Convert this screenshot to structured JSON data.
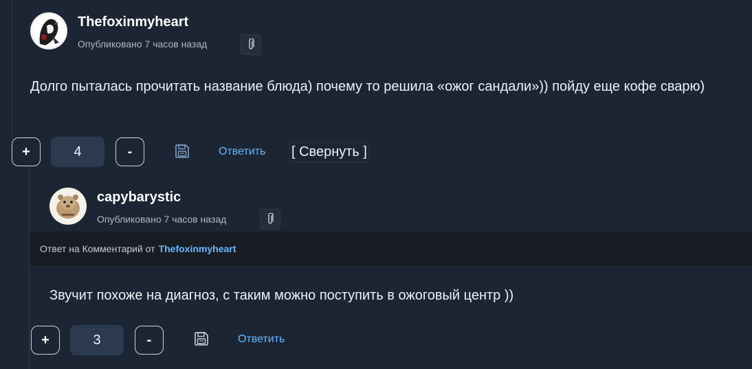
{
  "comments": [
    {
      "author": "Thefoxinmyheart",
      "meta": "Опубликовано 7 часов назад",
      "text": "Долго пыталась прочитать название блюда) почему то решила «ожог сандали»)) пойду еще кофе сварю)",
      "vote_plus": "+",
      "vote_count": "4",
      "vote_minus": "-",
      "reply_label": "Ответить",
      "collapse_label": "[ Свернуть ]",
      "save_icon": "save-floppy-icon",
      "clip_icon": "paperclip-icon"
    },
    {
      "author": "capybarystic",
      "meta": "Опубликовано 7 часов назад",
      "reply_prefix": "Ответ на Комментарий от",
      "reply_target": "Thefoxinmyheart",
      "text": "Звучит похоже на диагноз, с таким можно поступить в ожоговый центр ))",
      "vote_plus": "+",
      "vote_count": "3",
      "vote_minus": "-",
      "reply_label": "Ответить",
      "save_icon": "save-floppy-icon",
      "clip_icon": "paperclip-icon"
    }
  ],
  "colors": {
    "background": "#1c2533",
    "link": "#69b7ff",
    "vote_count_bg": "#2b3a4f",
    "reply_bar_bg": "#181d24"
  }
}
